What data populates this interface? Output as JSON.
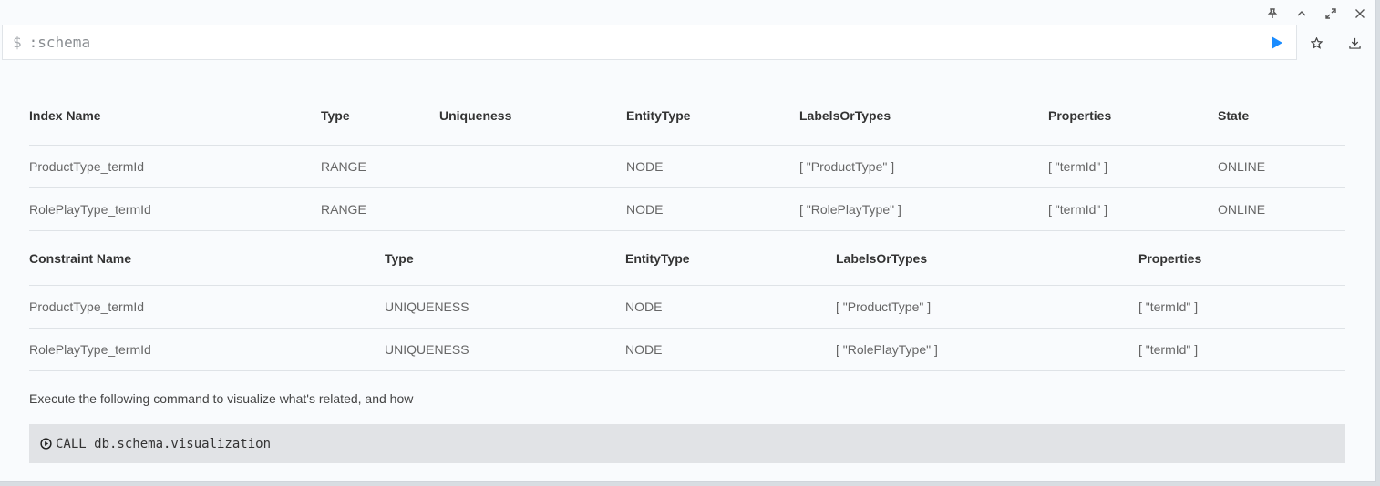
{
  "editor": {
    "prompt": "$",
    "query": ":schema"
  },
  "indexes": {
    "headers": [
      "Index Name",
      "Type",
      "Uniqueness",
      "EntityType",
      "LabelsOrTypes",
      "Properties",
      "State"
    ],
    "rows": [
      [
        "ProductType_termId",
        "RANGE",
        "",
        "NODE",
        "[ \"ProductType\" ]",
        "[ \"termId\" ]",
        "ONLINE"
      ],
      [
        "RolePlayType_termId",
        "RANGE",
        "",
        "NODE",
        "[ \"RolePlayType\" ]",
        "[ \"termId\" ]",
        "ONLINE"
      ]
    ]
  },
  "constraints": {
    "headers": [
      "Constraint Name",
      "Type",
      "EntityType",
      "LabelsOrTypes",
      "Properties"
    ],
    "rows": [
      [
        "ProductType_termId",
        "UNIQUENESS",
        "NODE",
        "[ \"ProductType\" ]",
        "[ \"termId\" ]"
      ],
      [
        "RolePlayType_termId",
        "UNIQUENESS",
        "NODE",
        "[ \"RolePlayType\" ]",
        "[ \"termId\" ]"
      ]
    ]
  },
  "hint": "Execute the following command to visualize what's related, and how",
  "command": "CALL db.schema.visualization",
  "icons": {
    "frame": [
      "pin-icon",
      "collapse-icon",
      "fullscreen-icon",
      "close-icon"
    ],
    "actions": [
      "star-icon",
      "download-icon"
    ],
    "run": "play-icon",
    "run_color": "#1a8cff"
  }
}
